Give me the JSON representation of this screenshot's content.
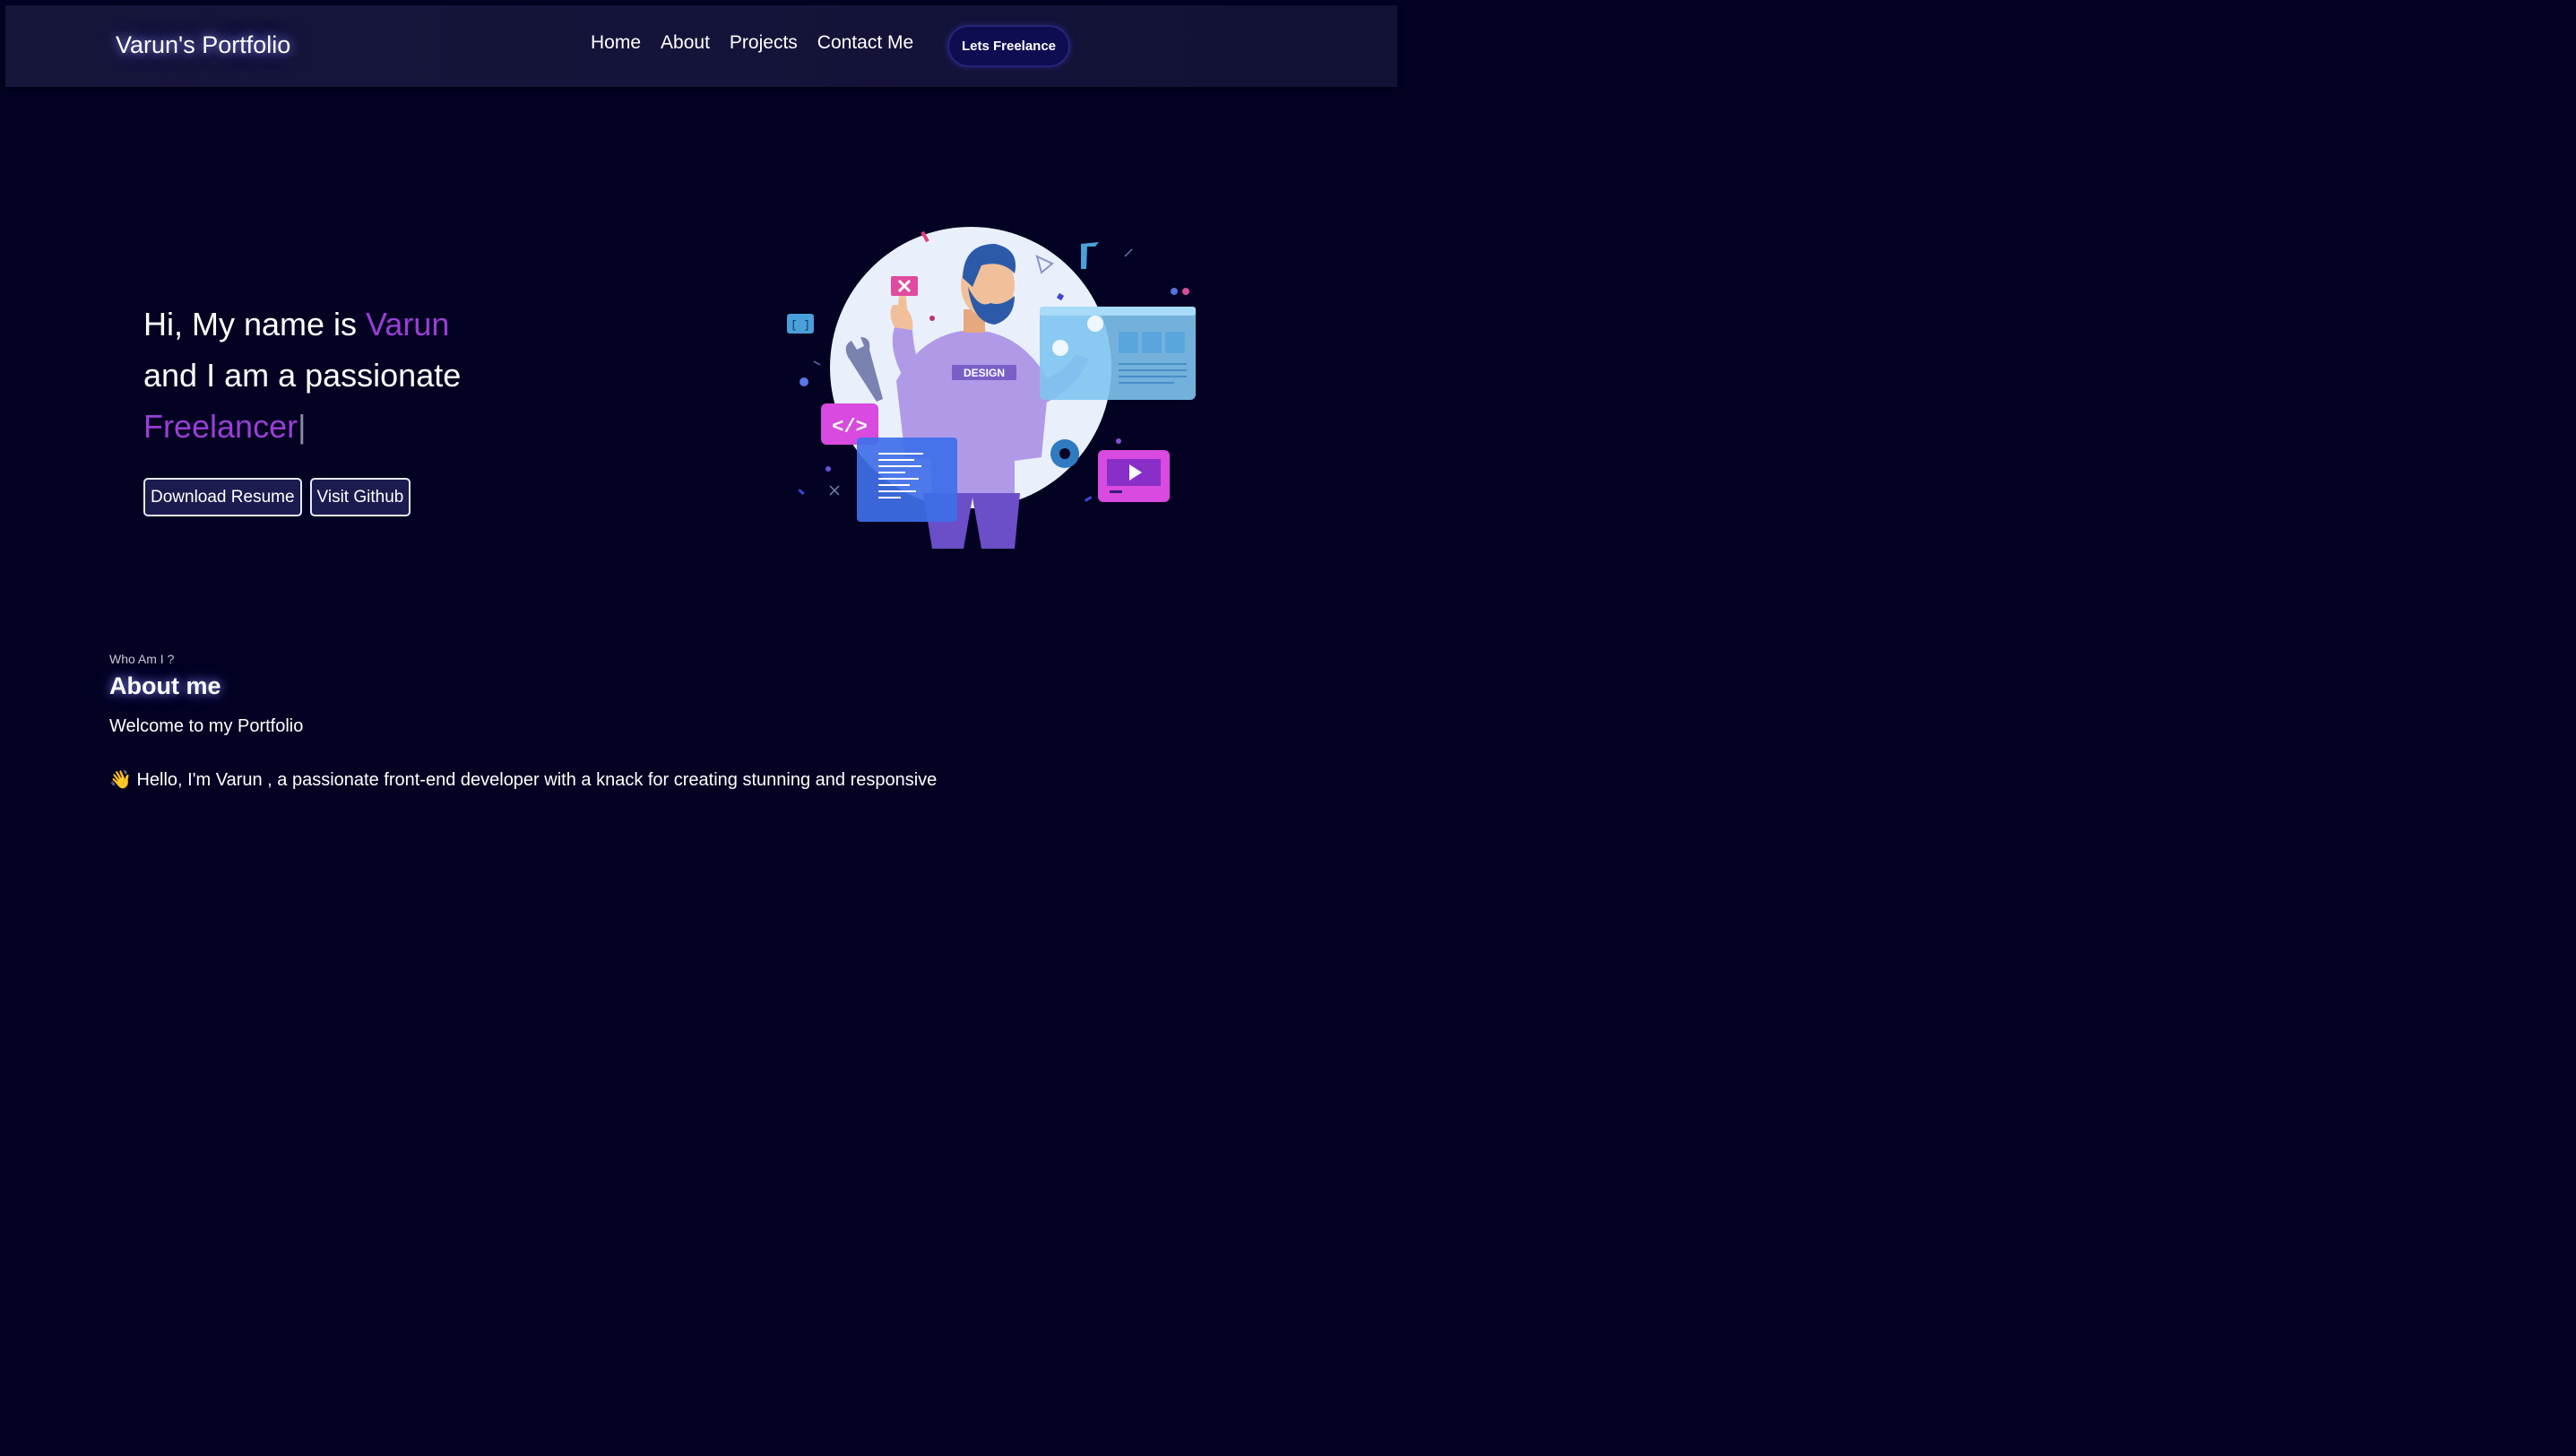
{
  "nav": {
    "brand": "Varun's Portfolio",
    "links": [
      "Home",
      "About",
      "Projects",
      "Contact Me"
    ],
    "cta": "Lets Freelance"
  },
  "hero": {
    "line1_prefix": "Hi, My name is ",
    "name": "Varun",
    "line2": "and I am a passionate",
    "role": "Freelancer",
    "cursor": "|",
    "buttons": [
      "Download Resume",
      "Visit Github"
    ]
  },
  "illustration": {
    "shirt_text": "DESIGN",
    "icons": [
      "code-icon",
      "settings-icon",
      "play-icon",
      "close-icon",
      "wrench-icon",
      "brackets-icon"
    ]
  },
  "about": {
    "kicker": "Who Am I ?",
    "title": "About me",
    "welcome": "Welcome to my Portfolio",
    "intro": "👋 Hello, I'm Varun , a passionate front-end developer with a knack for creating stunning and responsive"
  },
  "colors": {
    "background": "#030222",
    "navbar": "#141339",
    "accent": "#9a3ed6",
    "cta_bg": "#0f0d52"
  }
}
